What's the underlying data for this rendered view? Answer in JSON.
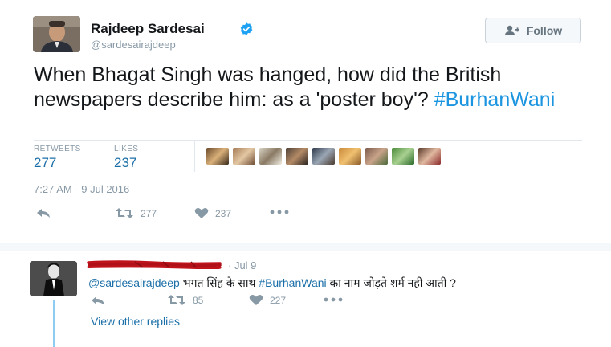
{
  "tweet": {
    "author_name": "Rajdeep Sardesai",
    "author_handle": "@sardesairajdeep",
    "follow_label": "Follow",
    "text_part1": "When Bhagat Singh was hanged, how did the British newspapers describe him: as a 'poster boy'? ",
    "hashtag": "#BurhanWani",
    "retweets_label": "RETWEETS",
    "retweets_count": "277",
    "likes_label": "LIKES",
    "likes_count": "237",
    "timestamp": "7:27 AM - 9 Jul 2016",
    "actions": {
      "retweet_count": "277",
      "like_count": "237"
    },
    "icons": [
      "verified-badge-icon",
      "follow-person-icon",
      "reply-icon",
      "retweet-icon",
      "heart-icon",
      "more-icon"
    ]
  },
  "reply": {
    "time": "· Jul 9",
    "mention": "@sardesairajdeep",
    "text_before": " भगत सिंह के साथ ",
    "hashtag": "#BurhanWani",
    "text_after": " का नाम जोड़ते शर्म नही आती ?",
    "retweet_count": "85",
    "like_count": "227",
    "view_other_replies": "View other replies"
  },
  "colors": {
    "link_blue": "#1b95e0",
    "stat_blue": "#1b6fa8",
    "muted_gray": "#8899a6",
    "verified_blue": "#1da1f2",
    "thread_line": "#8ecdf2",
    "redaction_red": "#c0141c"
  }
}
